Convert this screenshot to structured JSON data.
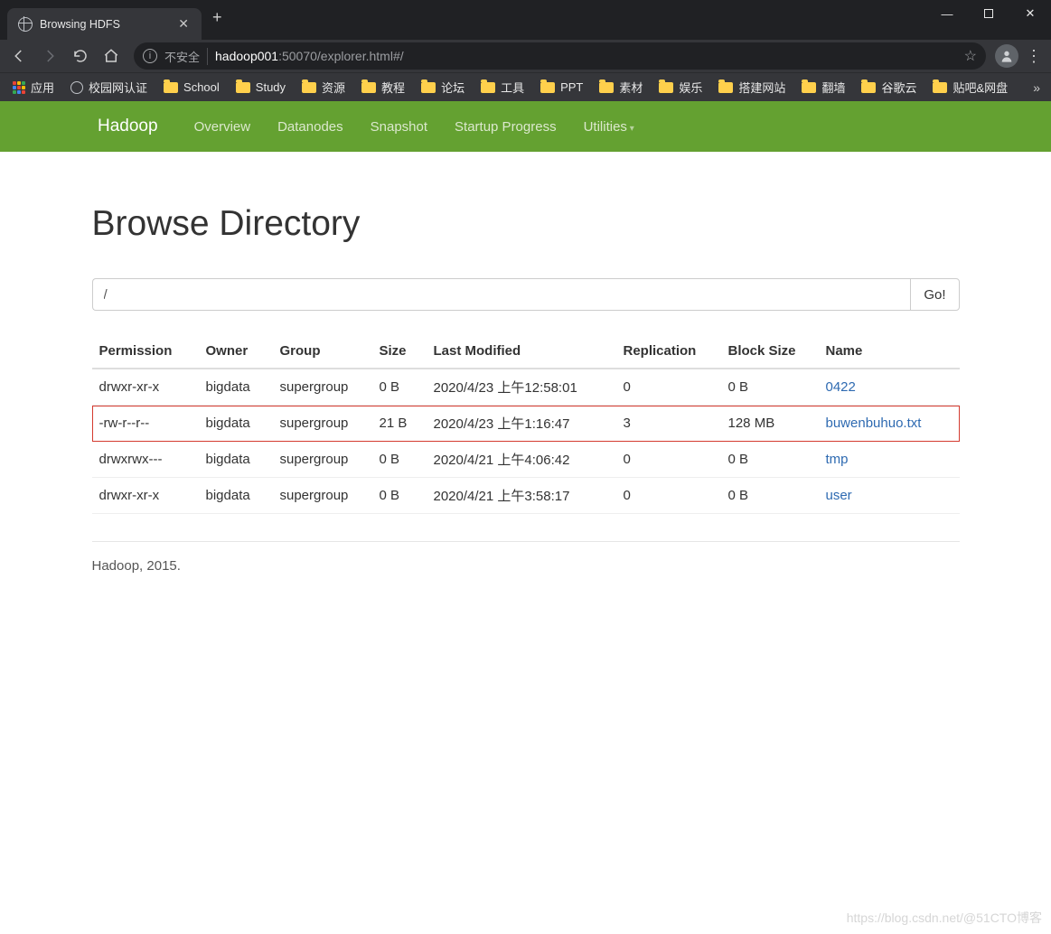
{
  "browser": {
    "tab_title": "Browsing HDFS",
    "url_host": "hadoop001",
    "url_rest": ":50070/explorer.html#/",
    "insecure_label": "不安全",
    "bookmarks": {
      "apps_label": "应用",
      "items": [
        "校园网认证",
        "School",
        "Study",
        "资源",
        "教程",
        "论坛",
        "工具",
        "PPT",
        "素材",
        "娱乐",
        "搭建网站",
        "翻墙",
        "谷歌云",
        "贴吧&网盘"
      ]
    }
  },
  "nav": {
    "brand": "Hadoop",
    "links": [
      "Overview",
      "Datanodes",
      "Snapshot",
      "Startup Progress"
    ],
    "utilities_label": "Utilities"
  },
  "page": {
    "title": "Browse Directory",
    "path_value": "/",
    "go_label": "Go!",
    "columns": [
      "Permission",
      "Owner",
      "Group",
      "Size",
      "Last Modified",
      "Replication",
      "Block Size",
      "Name"
    ],
    "rows": [
      {
        "perm": "drwxr-xr-x",
        "owner": "bigdata",
        "group": "supergroup",
        "size": "0 B",
        "mtime": "2020/4/23 上午12:58:01",
        "rep": "0",
        "bs": "0 B",
        "name": "0422",
        "hl": false
      },
      {
        "perm": "-rw-r--r--",
        "owner": "bigdata",
        "group": "supergroup",
        "size": "21 B",
        "mtime": "2020/4/23 上午1:16:47",
        "rep": "3",
        "bs": "128 MB",
        "name": "buwenbuhuo.txt",
        "hl": true
      },
      {
        "perm": "drwxrwx---",
        "owner": "bigdata",
        "group": "supergroup",
        "size": "0 B",
        "mtime": "2020/4/21 上午4:06:42",
        "rep": "0",
        "bs": "0 B",
        "name": "tmp",
        "hl": false
      },
      {
        "perm": "drwxr-xr-x",
        "owner": "bigdata",
        "group": "supergroup",
        "size": "0 B",
        "mtime": "2020/4/21 上午3:58:17",
        "rep": "0",
        "bs": "0 B",
        "name": "user",
        "hl": false
      }
    ],
    "footer": "Hadoop, 2015."
  },
  "watermark": "https://blog.csdn.net/@51CTO博客"
}
